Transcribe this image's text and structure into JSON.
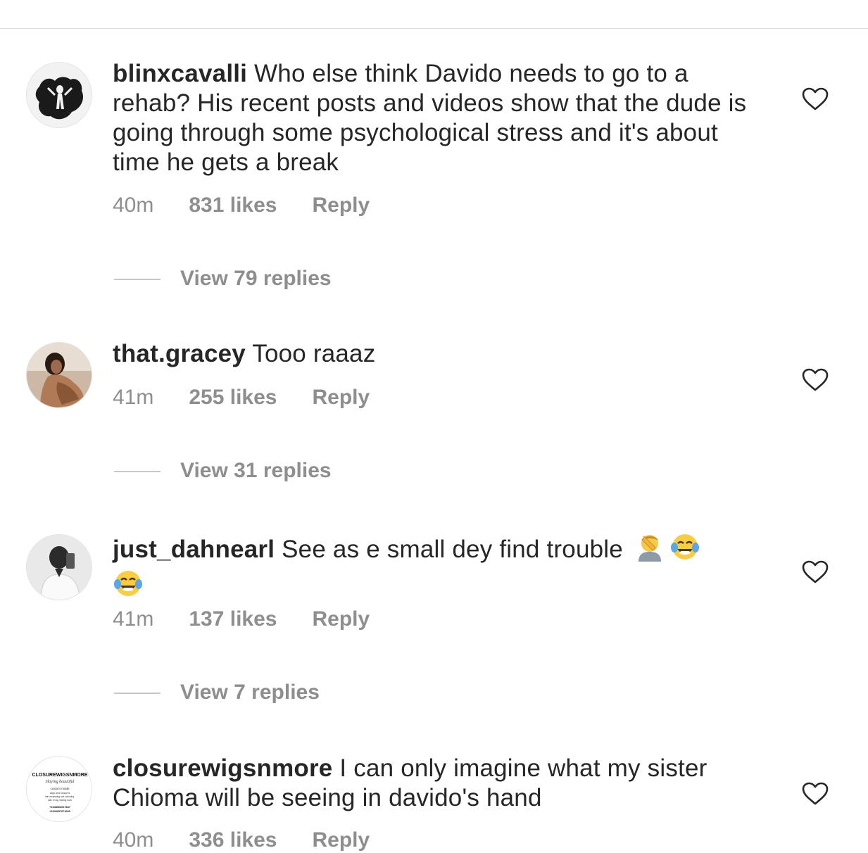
{
  "comments": [
    {
      "username": "blinxcavalli",
      "text": "Who else think Davido needs to go to a rehab? His recent posts and videos show that the dude is going through some psychological stress and it's about time he gets a break",
      "time": "40m",
      "likes": "831 likes",
      "reply": "Reply",
      "view_replies": "View 79 replies"
    },
    {
      "username": "that.gracey",
      "text": "Tooo raaaz",
      "time": "41m",
      "likes": "255 likes",
      "reply": "Reply",
      "view_replies": "View 31 replies"
    },
    {
      "username": "just_dahnearl",
      "text": "See as e small dey find trouble",
      "emoji": [
        "man-facepalming-emoji",
        "face-with-tears-of-joy-emoji",
        "face-with-tears-of-joy-emoji"
      ],
      "time": "41m",
      "likes": "137 likes",
      "reply": "Reply",
      "view_replies": "View 7 replies"
    },
    {
      "username": "closurewigsnmore",
      "text": "I can only imagine what my sister Chioma will be seeing in davido's hand",
      "time": "40m",
      "likes": "336 likes",
      "reply": "Reply",
      "avatar_text": [
        "CLOSUREWIGSNMORE",
        "Slaying beautiful",
        "custom made",
        "wigs and closures",
        "hair revamping and colouring,",
        "sale of wig making tools",
        "+2348063027847",
        "+2349037674000"
      ]
    }
  ],
  "colors": {
    "text": "#262626",
    "secondary": "#8e8e8e",
    "divider": "#dbdbdb"
  },
  "icons": {
    "like": "heart-outline-icon"
  }
}
